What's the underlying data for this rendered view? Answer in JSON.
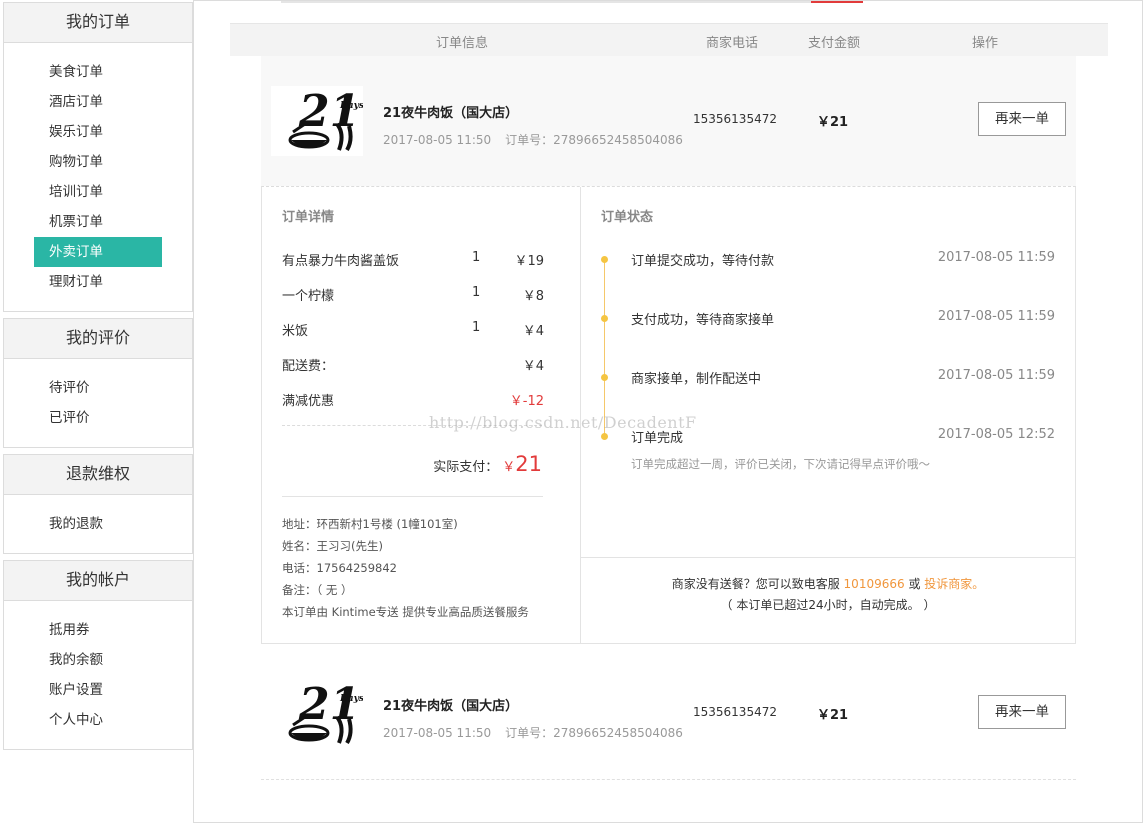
{
  "sidebar": {
    "sections": [
      {
        "title": "我的订单",
        "items": [
          "美食订单",
          "酒店订单",
          "娱乐订单",
          "购物订单",
          "培训订单",
          "机票订单",
          "外卖订单",
          "理财订单"
        ],
        "active_index": 6
      },
      {
        "title": "我的评价",
        "items": [
          "待评价",
          "已评价"
        ]
      },
      {
        "title": "退款维权",
        "items": [
          "我的退款"
        ]
      },
      {
        "title": "我的帐户",
        "items": [
          "抵用券",
          "我的余额",
          "账户设置",
          "个人中心"
        ]
      }
    ]
  },
  "table": {
    "headers": [
      "订单信息",
      "商家电话",
      "支付金额",
      "操作"
    ]
  },
  "orders": [
    {
      "shop": "21夜牛肉饭（国大店）",
      "time": "2017-08-05 11:50",
      "order_no": "订单号：27896652458504086",
      "phone": "15356135472",
      "amount": "￥21",
      "button": "再来一单",
      "logo_text": "21",
      "logo_small": "Days"
    },
    {
      "shop": "21夜牛肉饭（国大店）",
      "time": "2017-08-05 11:50",
      "order_no": "订单号：27896652458504086",
      "phone": "15356135472",
      "amount": "￥21",
      "button": "再来一单",
      "logo_text": "21",
      "logo_small": "Days"
    }
  ],
  "detail": {
    "left_title": "订单详情",
    "items": [
      {
        "name": "有点暴力牛肉酱盖饭",
        "qty": "1",
        "price": "￥19"
      },
      {
        "name": "一个柠檬",
        "qty": "1",
        "price": "￥8"
      },
      {
        "name": "米饭",
        "qty": "1",
        "price": "￥4"
      },
      {
        "name": "配送费：",
        "qty": "",
        "price": "￥4"
      },
      {
        "name": "满减优惠",
        "qty": "",
        "price": "￥-12"
      }
    ],
    "pay_label": "实际支付：",
    "pay_currency": "￥",
    "pay_value": "21",
    "address": "地址：环西新村1号楼 (1幢101室)",
    "name": "姓名：王习习(先生)",
    "tel": "电话：17564259842",
    "remark": "备注：（ 无 ）",
    "service": "本订单由 Kintime专送 提供专业高品质送餐服务",
    "right_title": "订单状态",
    "timeline": [
      {
        "text": "订单提交成功，等待付款",
        "time": "2017-08-05 11:59"
      },
      {
        "text": "支付成功，等待商家接单",
        "time": "2017-08-05 11:59"
      },
      {
        "text": "商家接单，制作配送中",
        "time": "2017-08-05 11:59"
      },
      {
        "text": "订单完成",
        "time": "2017-08-05 12:52"
      }
    ],
    "timeline_note": "订单完成超过一周，评价已关闭，下次请记得早点评价哦～",
    "foot_prefix": "商家没有送餐？您可以致电客服 ",
    "foot_hotline": "10109666",
    "foot_mid": " 或 ",
    "foot_complain": "投诉商家。",
    "foot_line2": "（ 本订单已超过24小时，自动完成。 ）"
  },
  "watermark": "http://blog.csdn.net/DecadentF",
  "colors": {
    "accent": "#2ab6a5",
    "price_red": "#e23b3b",
    "timeline_dot": "#f5c542",
    "link_orange": "#f0963c"
  }
}
